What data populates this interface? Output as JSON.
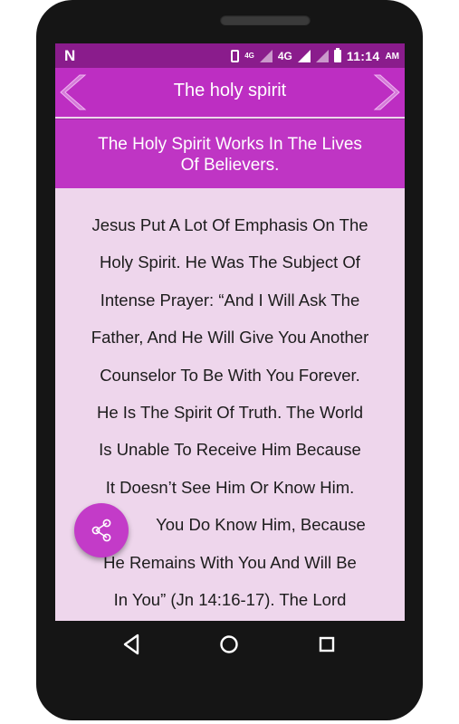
{
  "status_bar": {
    "notification_icon": "N",
    "vibrate_icon": "vibrate-icon",
    "net_small": "4G",
    "net_large": "4G",
    "time": "11:14",
    "ampm": "AM",
    "text_color": "#ffffff",
    "background": "#8a1c8c"
  },
  "app_bar": {
    "title": "The holy spirit",
    "prev_icon": "chevron-left-icon",
    "next_icon": "chevron-right-icon",
    "background": "#bd2ec2"
  },
  "article": {
    "heading_lines": [
      "The Holy Spirit Works In The Lives",
      "Of Believers."
    ],
    "body_lines": [
      "Jesus Put A Lot Of Emphasis On The",
      "Holy Spirit. He Was The Subject Of",
      "Intense Prayer: “And I Will Ask The",
      "Father, And He Will Give You Another",
      "Counselor To Be With You Forever.",
      "He Is The Spirit Of Truth. The World",
      "Is Unable To Receive Him Because",
      "It Doesn’t See Him Or Know Him.",
      "You Do Know Him, Because",
      "He Remains With You And Will Be",
      "In You” (Jn 14:16-17). The Lord"
    ],
    "background": "#eed6ec"
  },
  "fab": {
    "icon": "share-icon",
    "color": "#c33bc8"
  },
  "system_nav": {
    "back_icon": "back-triangle-icon",
    "home_icon": "home-circle-icon",
    "recents_icon": "recents-square-icon"
  }
}
